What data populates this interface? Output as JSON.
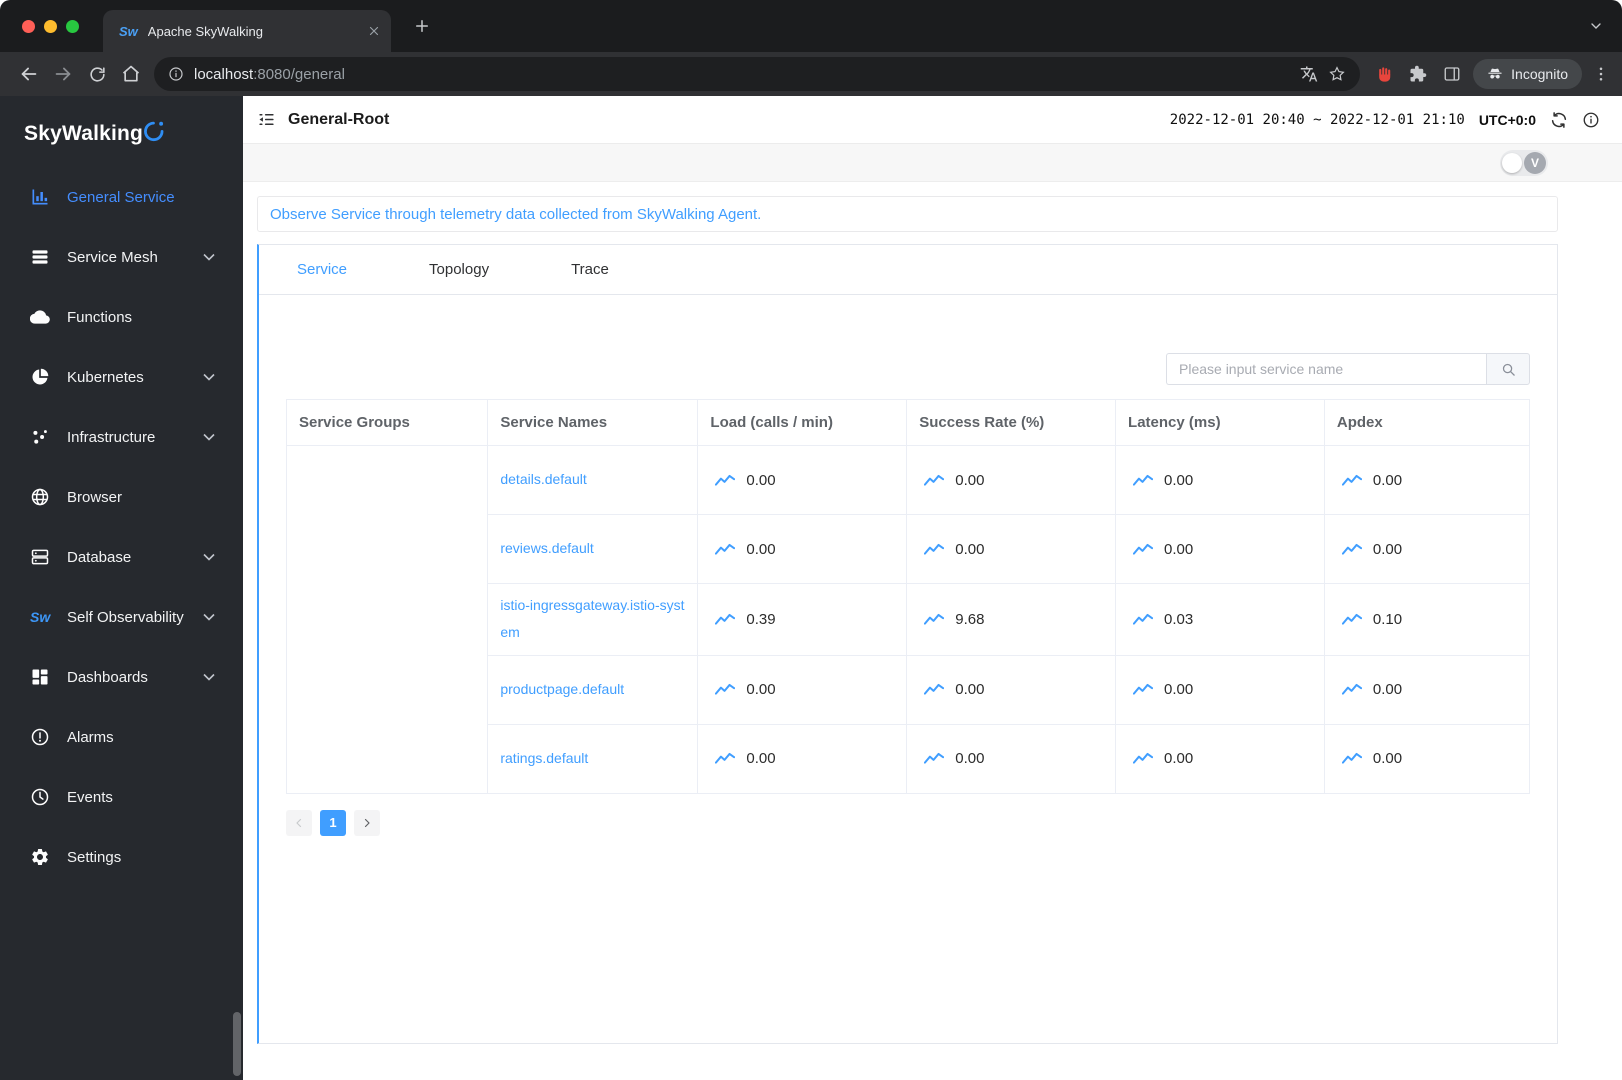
{
  "colors": {
    "accent": "#409eff",
    "active_menu": "#448dfe"
  },
  "browser": {
    "tab": {
      "title": "Apache SkyWalking",
      "favicon": "Sw"
    },
    "address": {
      "host": "localhost",
      "path": ":8080/general"
    },
    "incognito_label": "Incognito"
  },
  "sidebar": {
    "logo_text": "SkyWalking",
    "items": [
      {
        "label": "General Service",
        "icon": "bar-chart",
        "active": true,
        "expandable": false
      },
      {
        "label": "Service Mesh",
        "icon": "layers",
        "active": false,
        "expandable": true
      },
      {
        "label": "Functions",
        "icon": "cloud",
        "active": false,
        "expandable": false
      },
      {
        "label": "Kubernetes",
        "icon": "kubernetes",
        "active": false,
        "expandable": true
      },
      {
        "label": "Infrastructure",
        "icon": "infrastructure",
        "active": false,
        "expandable": true
      },
      {
        "label": "Browser",
        "icon": "globe",
        "active": false,
        "expandable": false
      },
      {
        "label": "Database",
        "icon": "database",
        "active": false,
        "expandable": true
      },
      {
        "label": "Self Observability",
        "icon": "sw-logo",
        "active": false,
        "expandable": true
      },
      {
        "label": "Dashboards",
        "icon": "dashboard-grid",
        "active": false,
        "expandable": true
      },
      {
        "label": "Alarms",
        "icon": "alarm",
        "active": false,
        "expandable": false
      },
      {
        "label": "Events",
        "icon": "clock",
        "active": false,
        "expandable": false
      },
      {
        "label": "Settings",
        "icon": "gear",
        "active": false,
        "expandable": false
      }
    ]
  },
  "header": {
    "title": "General-Root",
    "time_range": "2022-12-01 20:40 ~ 2022-12-01 21:10",
    "timezone": "UTC+0:0"
  },
  "sub_toolbar": {
    "badge": "V"
  },
  "main": {
    "notice": "Observe Service through telemetry data collected from SkyWalking Agent.",
    "tabs": [
      {
        "label": "Service",
        "active": true
      },
      {
        "label": "Topology",
        "active": false
      },
      {
        "label": "Trace",
        "active": false
      }
    ],
    "search": {
      "placeholder": "Please input service name"
    },
    "table": {
      "columns": [
        "Service Groups",
        "Service Names",
        "Load (calls / min)",
        "Success Rate (%)",
        "Latency (ms)",
        "Apdex"
      ],
      "rows": [
        {
          "group": "",
          "name": "details.default",
          "load": "0.00",
          "success_rate": "0.00",
          "latency": "0.00",
          "apdex": "0.00"
        },
        {
          "group": "",
          "name": "reviews.default",
          "load": "0.00",
          "success_rate": "0.00",
          "latency": "0.00",
          "apdex": "0.00"
        },
        {
          "group": "",
          "name": "istio-ingressgateway.istio-system",
          "load": "0.39",
          "success_rate": "9.68",
          "latency": "0.03",
          "apdex": "0.10"
        },
        {
          "group": "",
          "name": "productpage.default",
          "load": "0.00",
          "success_rate": "0.00",
          "latency": "0.00",
          "apdex": "0.00"
        },
        {
          "group": "",
          "name": "ratings.default",
          "load": "0.00",
          "success_rate": "0.00",
          "latency": "0.00",
          "apdex": "0.00"
        }
      ]
    },
    "pagination": {
      "current": "1"
    }
  }
}
